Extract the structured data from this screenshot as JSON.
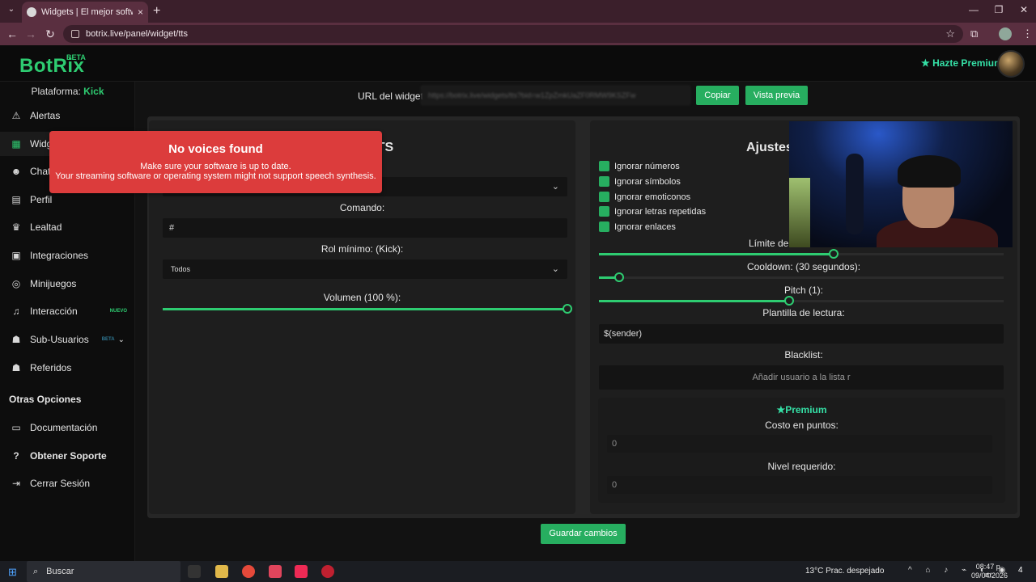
{
  "browser": {
    "tab_title": "Widgets | El mejor software par",
    "url": "botrix.live/panel/widget/tts",
    "tab_list_icon": "chevron-down-icon",
    "new_tab": "+",
    "close_tab": "×",
    "min": "—",
    "restore": "❐",
    "close": "✕",
    "back": "←",
    "forward": "→",
    "reload": "↻",
    "bookmark": "☆",
    "extensions": "⧉",
    "menu": "⋮"
  },
  "header": {
    "logo": "BotRix",
    "logo_badge": "BETA",
    "premium_cta": "★ Hazte Premium"
  },
  "sidebar": {
    "platform_label": "Plataforma:",
    "platform_value": "Kick",
    "items": [
      {
        "label": "Alertas",
        "icon": "⚠"
      },
      {
        "label": "Widgets",
        "icon": "▦"
      },
      {
        "label": "Chat",
        "icon": "☻"
      },
      {
        "label": "Perfil",
        "icon": "▤"
      },
      {
        "label": "Lealtad",
        "icon": "♛"
      },
      {
        "label": "Integraciones",
        "icon": "▣"
      },
      {
        "label": "Minijuegos",
        "icon": "◎"
      },
      {
        "label": "Interacción",
        "icon": "♫",
        "badge": "NUEVO"
      },
      {
        "label": "Sub-Usuarios",
        "icon": "☗",
        "badge": "BETA"
      },
      {
        "label": "Referidos",
        "icon": "☗"
      }
    ],
    "section_title": "Otras Opciones",
    "other_items": [
      {
        "label": "Documentación",
        "icon": "▭"
      },
      {
        "label": "Obtener Soporte",
        "icon": "?"
      },
      {
        "label": "Cerrar Sesión",
        "icon": "⇥"
      }
    ]
  },
  "widget_bar": {
    "url_label": "URL del widget:",
    "url_value": "https://botrix.live/widgets/tts?bid=w1ZpZmkUaZF0RMW9KSZFw",
    "copy_label": "Copiar",
    "preview_label": "Vista previa"
  },
  "left_card": {
    "title_fragment": "TTS",
    "command_label": "Comando:",
    "command_value": "#",
    "role_label": "Rol mínimo: (Kick):",
    "role_value": "Todos",
    "volume_label": "Volumen (100 %):",
    "volume_fraction": 1.0
  },
  "right_card": {
    "title_fragment": "Ajustes",
    "checkboxes": [
      "Ignorar números",
      "Ignorar símbolos",
      "Ignorar emoticonos",
      "Ignorar letras repetidas",
      "Ignorar enlaces"
    ],
    "limit_label": "Límite de",
    "limit_fraction": 0.58,
    "cooldown_label": "Cooldown: (30 segundos):",
    "cooldown_fraction": 0.05,
    "pitch_label": "Pitch (1):",
    "pitch_fraction": 0.47,
    "template_label": "Plantilla de lectura:",
    "template_value": "$(sender)",
    "blacklist_label": "Blacklist:",
    "blacklist_placeholder": "Añadir usuario a la lista r",
    "premium_title": "★Premium",
    "cost_label": "Costo en puntos:",
    "cost_value": "0",
    "level_label": "Nivel requerido:",
    "level_value": "0"
  },
  "save_label": "Guardar cambios",
  "toast": {
    "title": "No voices found",
    "line1": "Make sure your software is up to date.",
    "line2": "Your streaming software or operating system might not support speech synthesis."
  },
  "taskbar": {
    "start": "⊞",
    "search_icon": "⌕",
    "search_label": "Buscar",
    "weather": "13°C  Prac. despejado",
    "time": "08:47 p. m.",
    "date": "09/04/2026",
    "tray": "^ ⌂ ♪ ⌁ ◐ ◉",
    "notif_count": "4"
  }
}
